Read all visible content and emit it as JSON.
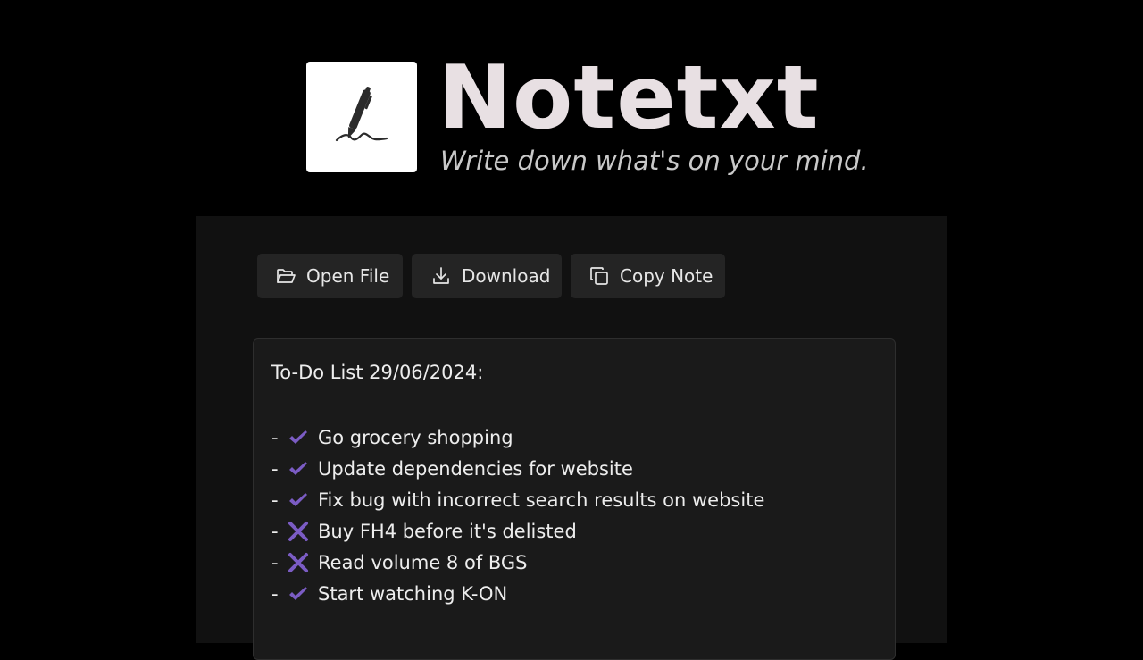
{
  "header": {
    "title": "Notetxt",
    "tagline": "Write down what's on your mind."
  },
  "toolbar": {
    "open_label": "Open File",
    "download_label": "Download",
    "copy_label": "Copy Note"
  },
  "note": {
    "title": "To-Do List 29/06/2024:",
    "items": [
      {
        "prefix": "-",
        "status": "done",
        "text": "Go grocery shopping"
      },
      {
        "prefix": "-",
        "status": "done",
        "text": "Update dependencies for website"
      },
      {
        "prefix": "-",
        "status": "done",
        "text": "Fix bug with incorrect search results on website"
      },
      {
        "prefix": "-",
        "status": "not-done",
        "text": "Buy FH4 before it's delisted"
      },
      {
        "prefix": "-",
        "status": "not-done",
        "text": "Read volume 8 of BGS"
      },
      {
        "prefix": "-",
        "status": "done",
        "text": "Start watching K-ON"
      }
    ]
  },
  "icons": {
    "logo": "pen-signature-icon",
    "open": "folder-open-icon",
    "download": "download-icon",
    "copy": "copy-icon",
    "done": "check-mark-icon",
    "not_done": "cross-mark-icon"
  },
  "colors": {
    "background": "#000000",
    "panel": "#111111",
    "editor": "#1a1a1a",
    "button": "#242424",
    "title": "#e8e0e3",
    "accent": "#7b5cc4"
  }
}
